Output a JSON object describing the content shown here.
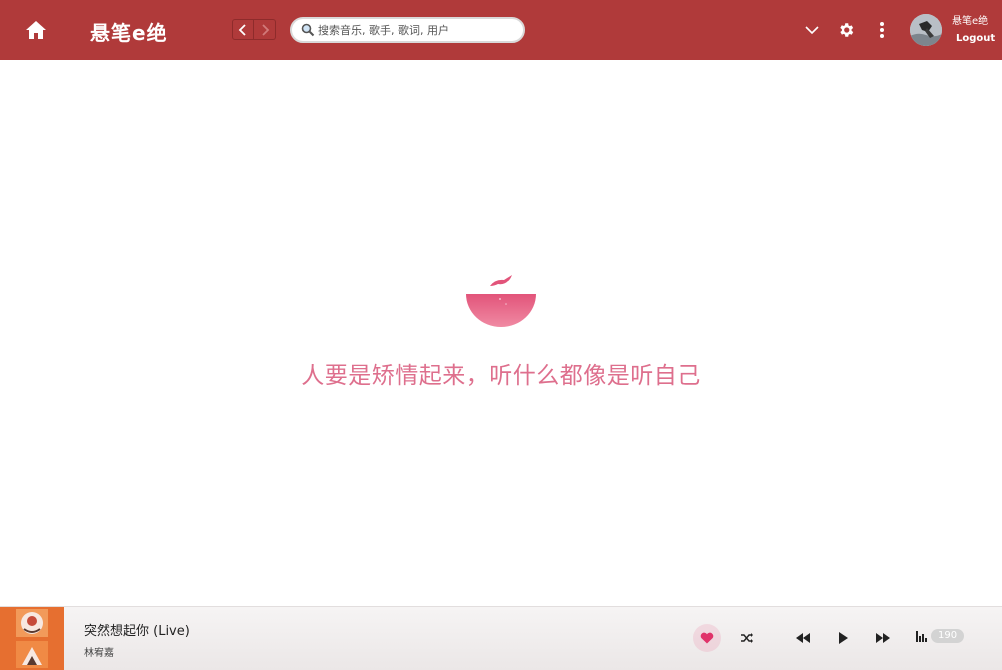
{
  "header": {
    "logo_text": "悬笔e绝",
    "search_placeholder": "搜索音乐, 歌手, 歌词, 用户",
    "username": "悬笔e绝",
    "logout_label": "Logout",
    "icons": [
      "home-icon",
      "chevron-left-icon",
      "chevron-right-icon",
      "search-icon",
      "chevron-down-icon",
      "gear-icon",
      "more-vertical-icon"
    ]
  },
  "main": {
    "empty_message": "人要是矫情起来，听什么都像是听自己"
  },
  "player": {
    "song_title": "突然想起你 (Live)",
    "artist": "林宥嘉",
    "queue_count": "190",
    "icons": [
      "heart-icon",
      "shuffle-icon",
      "previous-icon",
      "play-icon",
      "next-icon",
      "playlist-icon"
    ]
  },
  "colors": {
    "header_bg": "#b03a3a",
    "accent_pink": "#de6f8d",
    "player_bg": "#f1eeee"
  }
}
